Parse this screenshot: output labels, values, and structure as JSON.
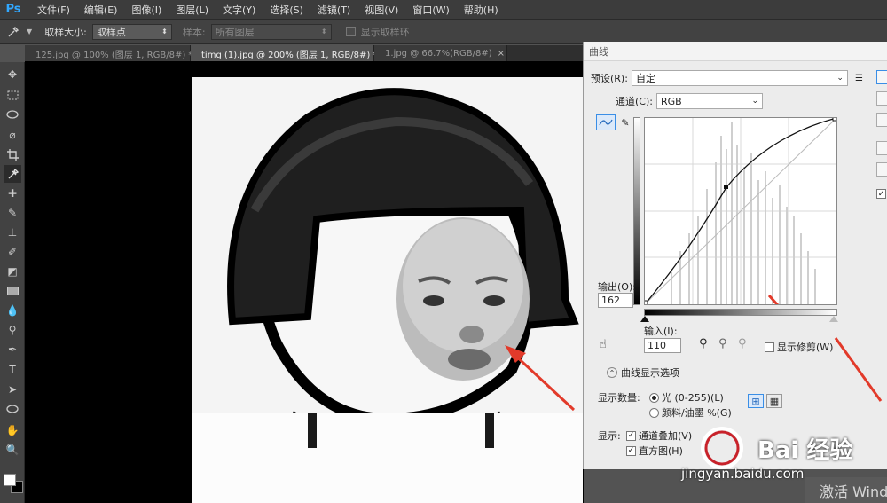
{
  "app": {
    "logo": "Ps"
  },
  "menu": [
    "文件(F)",
    "编辑(E)",
    "图像(I)",
    "图层(L)",
    "文字(Y)",
    "选择(S)",
    "滤镜(T)",
    "视图(V)",
    "窗口(W)",
    "帮助(H)"
  ],
  "options": {
    "sample_size_label": "取样大小:",
    "sample_size_value": "取样点",
    "sample_label": "样本:",
    "sample_value": "所有图层",
    "show_ring_label": "显示取样环"
  },
  "tabs": [
    {
      "label": "125.jpg @ 100% (图层 1, RGB/8#) *",
      "active": false
    },
    {
      "label": "timg (1).jpg @ 200% (图层 1, RGB/8#) *",
      "active": true
    },
    {
      "label": "1.jpg @ 66.7%(RGB/8#)",
      "active": false
    }
  ],
  "tab_close": "×",
  "curves": {
    "title": "曲线",
    "preset_label": "预设(R):",
    "preset_value": "自定",
    "channel_label": "通道(C):",
    "channel_value": "RGB",
    "output_label": "输出(O):",
    "output_value": "162",
    "input_label": "输入(I):",
    "input_value": "110",
    "show_clipping_label": "显示修剪(W)",
    "display_options_label": "曲线显示选项",
    "display_amount_label": "显示数量:",
    "light_label": "光 (0-255)(L)",
    "pigment_label": "颜料/油墨 %(G)",
    "show_label": "显示:",
    "channel_overlay_label": "通道叠加(V)",
    "histogram_label": "直方图(H)",
    "check_mark": "✓",
    "preview_check": "✓"
  },
  "watermark": {
    "brand": "Bai 经验",
    "url": "jingyan.baidu.com"
  },
  "os_notice": "激活 Windows",
  "colors": {
    "ps_blue": "#31a8ff",
    "arrow_red": "#e23a2a",
    "dialog_bg": "#ececec"
  }
}
